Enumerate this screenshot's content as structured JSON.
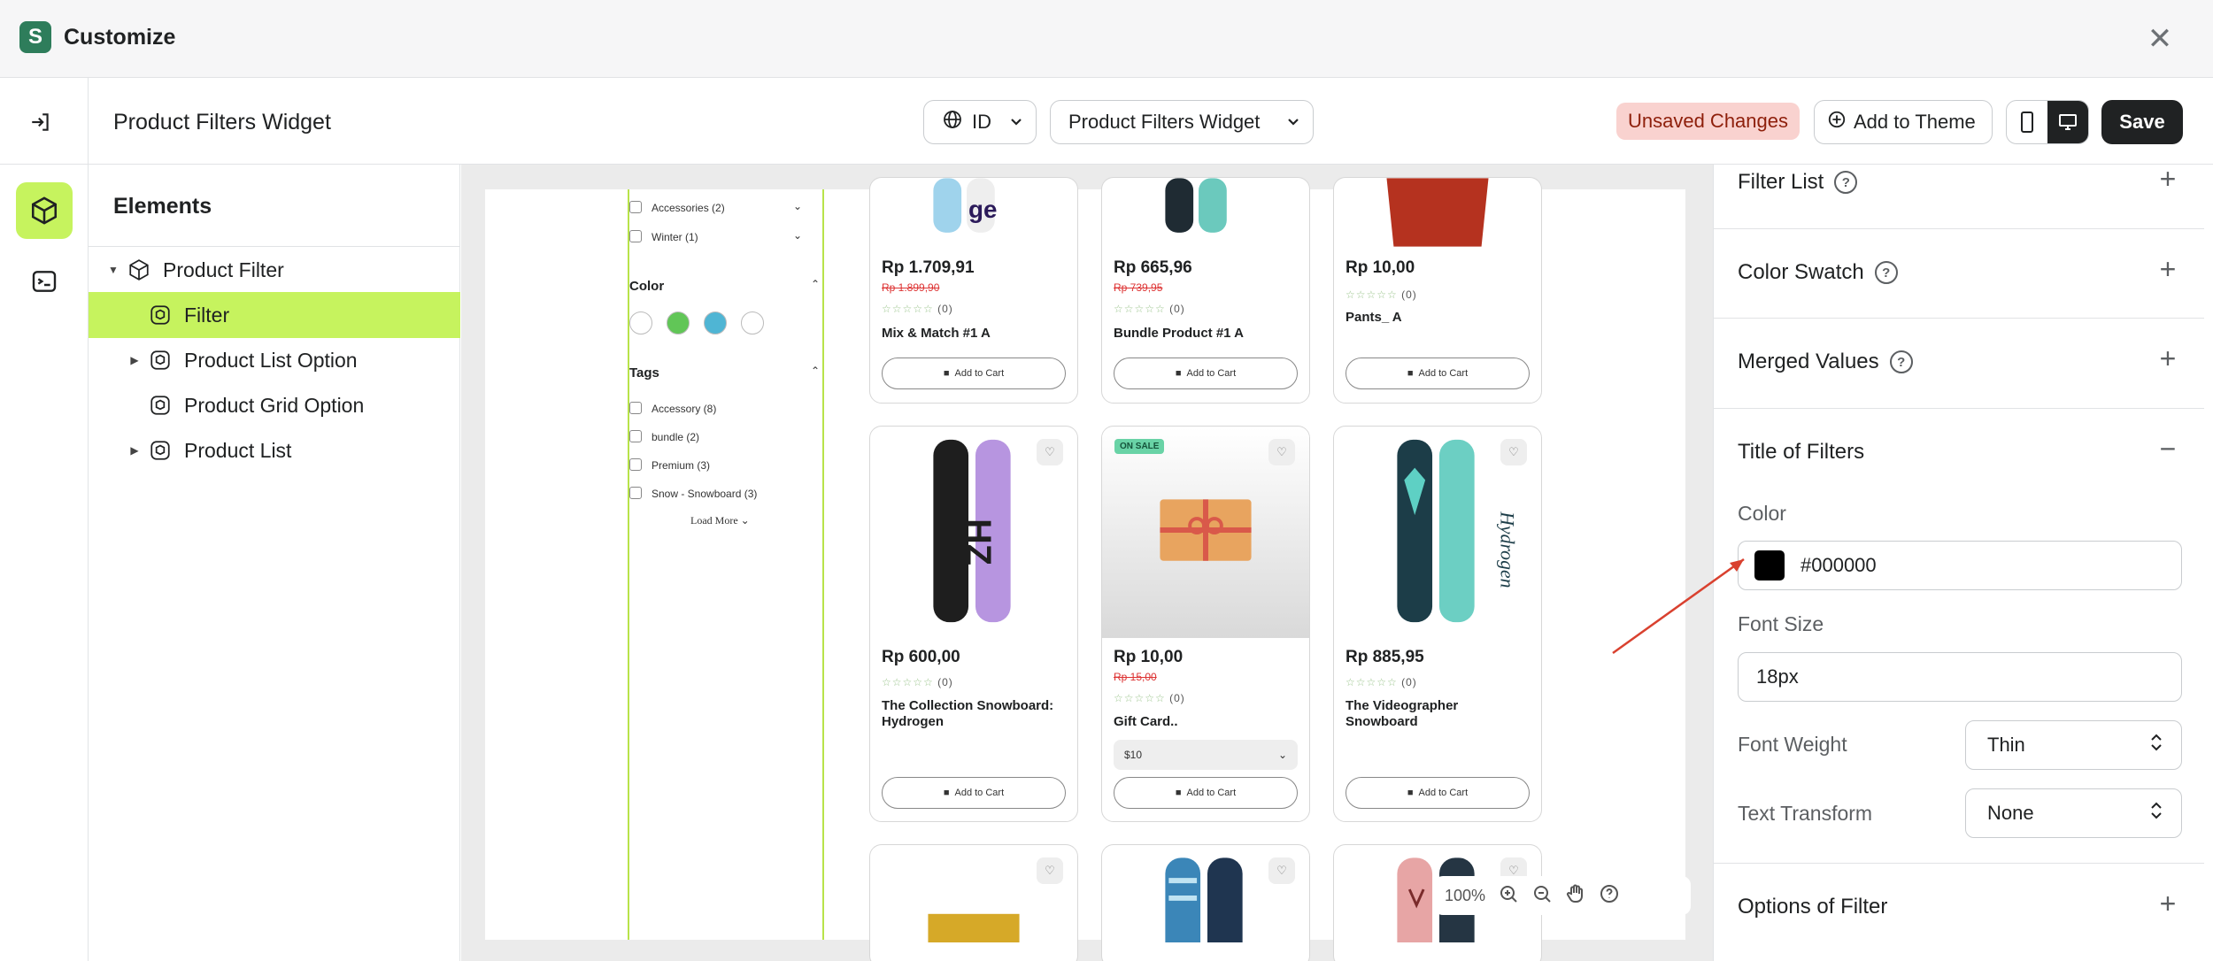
{
  "app": {
    "title": "Customize",
    "logo_letter": "S",
    "close_glyph": "✕"
  },
  "toolbar": {
    "page_title": "Product Filters Widget",
    "language": "ID",
    "widget_selector": "Product Filters Widget",
    "unsaved_label": "Unsaved Changes",
    "add_to_theme_label": "Add to Theme",
    "save_label": "Save"
  },
  "elements_panel": {
    "heading": "Elements",
    "tree": [
      {
        "label": "Product Filter",
        "expanded": true,
        "selected": false
      },
      {
        "label": "Filter",
        "selected": true
      },
      {
        "label": "Product List Option",
        "expanded": false,
        "selected": false
      },
      {
        "label": "Product Grid Option",
        "selected": false
      },
      {
        "label": "Product List",
        "expanded": false,
        "selected": false
      }
    ]
  },
  "preview": {
    "filters": {
      "collections": [
        {
          "label": "Accessories (2)"
        },
        {
          "label": "Winter (1)"
        }
      ],
      "color_heading": "Color",
      "colors": [
        "#ffffff",
        "#61c657",
        "#4fb5d4",
        "#ffffff"
      ],
      "tags_heading": "Tags",
      "tags": [
        "Accessory (8)",
        "bundle (2)",
        "Premium (3)",
        "Snow - Snowboard (3)"
      ],
      "load_more": "Load More"
    },
    "products": [
      {
        "price": "Rp 1.709,91",
        "old_price": "Rp 1.899,90",
        "rating_count": "(0)",
        "name": "Mix & Match #1 A",
        "cta": "Add to Cart"
      },
      {
        "price": "Rp 665,96",
        "old_price": "Rp 739,95",
        "rating_count": "(0)",
        "name": "Bundle Product #1 A",
        "cta": "Add to Cart"
      },
      {
        "price": "Rp 10,00",
        "old_price": "",
        "rating_count": "(0)",
        "name": "Pants_ A",
        "cta": "Add to Cart"
      },
      {
        "price": "Rp 600,00",
        "old_price": "",
        "rating_count": "(0)",
        "name": "The Collection Snowboard: Hydrogen",
        "cta": "Add to Cart"
      },
      {
        "price": "Rp 10,00",
        "old_price": "Rp 15,00",
        "rating_count": "(0)",
        "name": "Gift Card..",
        "cta": "Add to Cart",
        "badge": "ON SALE",
        "variant": "$10"
      },
      {
        "price": "Rp 885,95",
        "old_price": "",
        "rating_count": "(0)",
        "name": "The Videographer Snowboard",
        "cta": "Add to Cart"
      }
    ],
    "stars": "☆☆☆☆☆",
    "zoom_level": "100%"
  },
  "settings": {
    "sections": {
      "filter_list": "Filter List",
      "color_swatch": "Color Swatch",
      "merged_values": "Merged Values",
      "title_of_filters": "Title of Filters",
      "options_of_filter": "Options of Filter"
    },
    "title_of_filters": {
      "color_label": "Color",
      "color_value": "#000000",
      "font_size_label": "Font Size",
      "font_size_value": "18px",
      "font_weight_label": "Font Weight",
      "font_weight_value": "Thin",
      "text_transform_label": "Text Transform",
      "text_transform_value": "None"
    }
  },
  "colors": {
    "accent": "#c6f35e",
    "unsaved_bg": "#f9d2cf",
    "annotation_arrow": "#d9412f"
  }
}
